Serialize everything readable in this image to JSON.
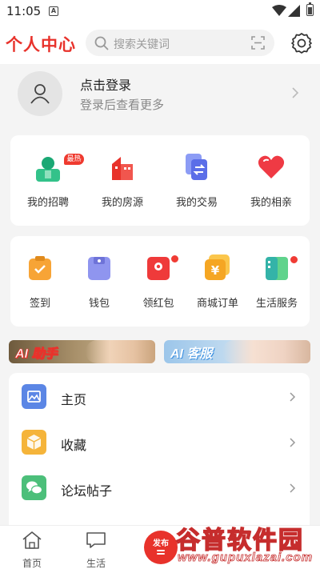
{
  "status_bar": {
    "time": "11:05",
    "notification_icon": "A"
  },
  "header": {
    "title": "个人中心",
    "search_placeholder": "搜索关键词"
  },
  "login": {
    "primary": "点击登录",
    "secondary": "登录后查看更多"
  },
  "quick_links": [
    {
      "label": "我的招聘",
      "icon": "recruit-icon",
      "badge": "最热"
    },
    {
      "label": "我的房源",
      "icon": "house-icon"
    },
    {
      "label": "我的交易",
      "icon": "trade-icon"
    },
    {
      "label": "我的相亲",
      "icon": "heart-icon"
    }
  ],
  "services": [
    {
      "label": "签到",
      "icon": "checkin-icon",
      "dot": false
    },
    {
      "label": "钱包",
      "icon": "wallet-icon",
      "dot": false
    },
    {
      "label": "领红包",
      "icon": "red-packet-icon",
      "dot": true
    },
    {
      "label": "商城订单",
      "icon": "mall-order-icon",
      "dot": false
    },
    {
      "label": "生活服务",
      "icon": "life-service-icon",
      "dot": true
    }
  ],
  "banners": [
    {
      "label": "AI 助手"
    },
    {
      "label": "AI 客服"
    }
  ],
  "menu": [
    {
      "label": "主页",
      "icon": "home-page-icon",
      "color": "#5b86e5"
    },
    {
      "label": "收藏",
      "icon": "favorites-icon",
      "color": "#f5b43a"
    },
    {
      "label": "论坛帖子",
      "icon": "forum-icon",
      "color": "#4cbf7a"
    }
  ],
  "bottom_nav": [
    {
      "label": "首页",
      "icon": "home-icon"
    },
    {
      "label": "生活",
      "icon": "chat-icon"
    }
  ],
  "publish": {
    "label": "发布"
  },
  "watermark": {
    "line1": "谷普软件园",
    "line2": "www.gupuxlazai.com"
  },
  "colors": {
    "brand": "#e8322b",
    "background": "#f4f4f4"
  }
}
